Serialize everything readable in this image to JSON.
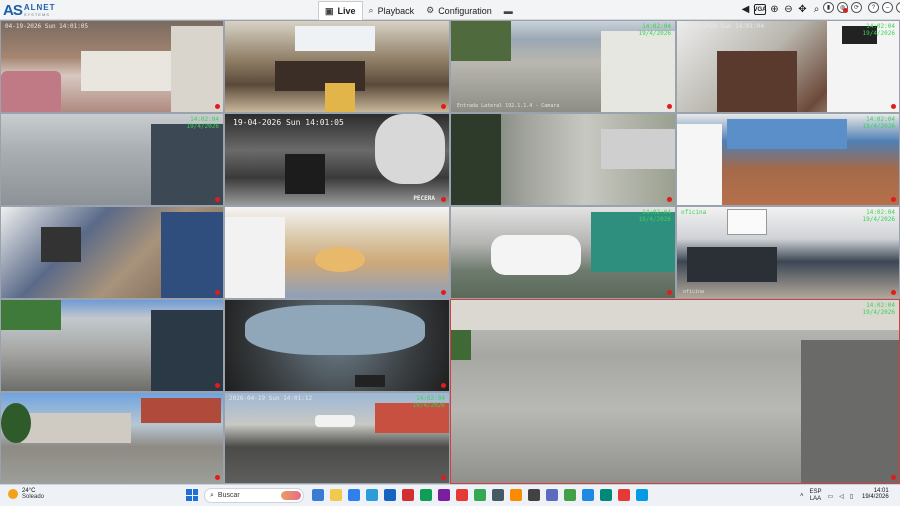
{
  "app": {
    "logo_mark": "AS",
    "logo_name": "ALNET",
    "logo_sub": "SYSTEMS"
  },
  "nav": {
    "tabs": [
      {
        "label": "Live",
        "icon": "video-camera-icon",
        "active": true
      },
      {
        "label": "Playback",
        "icon": "search-icon",
        "active": false
      },
      {
        "label": "Configuration",
        "icon": "gear-icon",
        "active": false
      },
      {
        "label": "",
        "icon": "folder-icon",
        "active": false
      }
    ]
  },
  "toolbar": {
    "items": [
      "volume-icon",
      "vga-icon",
      "zoom-in-icon",
      "zoom-out-icon",
      "move-icon",
      "magnify-icon"
    ],
    "vga_label": "VGA"
  },
  "window_controls": [
    "record-icon",
    "alarm-icon",
    "refresh-icon",
    "help-icon",
    "minimize-icon",
    "close-icon"
  ],
  "cameras": [
    {
      "id": "cam-1",
      "osd": "04-19-2026 Sun 14:01:05",
      "right_top": "",
      "caption": "",
      "caption_right": "",
      "scene": "store"
    },
    {
      "id": "cam-2",
      "osd": "",
      "right_top": "",
      "caption": "",
      "caption_right": "",
      "scene": "office"
    },
    {
      "id": "cam-3",
      "osd": "",
      "right_top": "14:02:04\n19/4/2026",
      "caption": "Entrada Lateral 192.1.1.4 - Camara",
      "caption_right": "",
      "scene": "street"
    },
    {
      "id": "cam-4",
      "osd": "04-19-2026 Sun 14:01:04",
      "right_top": "14:02:04\n19/4/2026",
      "caption": "",
      "caption_right": "",
      "scene": "room"
    },
    {
      "id": "cam-5",
      "osd": "",
      "right_top": "14:02:04\n19/4/2026",
      "caption": "",
      "caption_right": "",
      "scene": "yard"
    },
    {
      "id": "cam-6",
      "osd": "19-04-2026 Sun 14:01:05",
      "right_top": "",
      "caption": "",
      "caption_right": "PECERA",
      "scene": "night"
    },
    {
      "id": "cam-7",
      "osd": "",
      "right_top": "",
      "caption": "",
      "caption_right": "",
      "scene": "drive"
    },
    {
      "id": "cam-8",
      "osd": "",
      "right_top": "14:02:04\n19/4/2026",
      "caption": "",
      "caption_right": "",
      "scene": "shop"
    },
    {
      "id": "cam-9",
      "osd": "",
      "right_top": "14:02:04\n19/4/2026",
      "caption": "",
      "caption_right": "",
      "scene": "office"
    },
    {
      "id": "cam-10",
      "osd": "",
      "right_top": "",
      "caption": "",
      "caption_right": "",
      "scene": "kitchen"
    },
    {
      "id": "cam-11",
      "osd": "",
      "right_top": "14:02:04\n19/4/2026",
      "caption": "",
      "caption_right": "",
      "scene": "garage"
    },
    {
      "id": "cam-12",
      "osd": "oficina",
      "right_top": "14:02:04\n19/4/2026",
      "caption": "oficina",
      "caption_right": "",
      "scene": "office"
    },
    {
      "id": "cam-13",
      "osd": "",
      "right_top": "",
      "caption": "",
      "caption_right": "",
      "scene": "lot"
    },
    {
      "id": "cam-14",
      "osd": "",
      "right_top": "",
      "caption": "",
      "caption_right": "",
      "scene": "fisheye"
    },
    {
      "id": "cam-15",
      "osd": "",
      "right_top": "14:02:04\n19/4/2026",
      "caption": "",
      "caption_right": "",
      "scene": "street"
    },
    {
      "id": "cam-16",
      "osd": "",
      "right_top": "",
      "caption": "",
      "caption_right": "",
      "scene": "houses"
    },
    {
      "id": "cam-17",
      "osd": "2026-04-19 Sun 14:01:12",
      "right_top": "14:02:04\n19/4/2026",
      "caption": "",
      "caption_right": "",
      "scene": "road"
    }
  ],
  "taskbar": {
    "weather_temp": "24°C",
    "weather_cond": "Soleado",
    "search_placeholder": "Buscar",
    "apps": [
      "#3a7bd5",
      "#f2c94c",
      "#2f80ed",
      "#2d9cdb",
      "#1565c0",
      "#d32f2f",
      "#0f9d58",
      "#7b1fa2",
      "#e53935",
      "#34a853",
      "#455a64",
      "#fb8c00",
      "#424242",
      "#5c6bc0",
      "#43a047",
      "#1e88e5",
      "#00897b",
      "#e53935",
      "#039be5"
    ],
    "lang_top": "ESP",
    "lang_bottom": "LAA",
    "time": "14:01",
    "date": "19/4/2026"
  }
}
